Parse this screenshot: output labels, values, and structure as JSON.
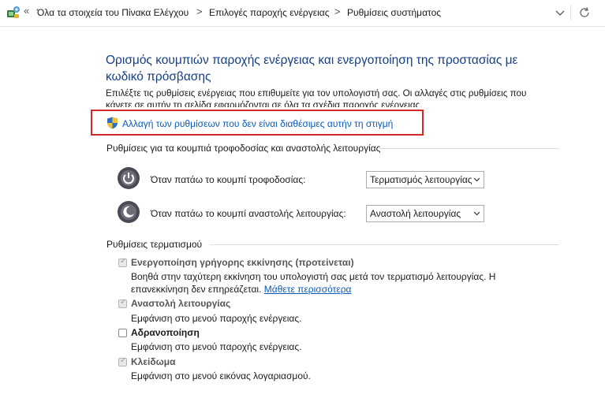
{
  "address_bar": {
    "crumbs": [
      "Όλα τα στοιχεία του Πίνακα Ελέγχου",
      "Επιλογές παροχής ενέργειας",
      "Ρυθμίσεις συστήματος"
    ],
    "separator": ">",
    "back_chevron": "«"
  },
  "page": {
    "title": "Ορισμός κουμπιών παροχής ενέργειας και ενεργοποίηση της προστασίας με κωδικό πρόσβασης",
    "description_line1": "Επιλέξτε τις ρυθμίσεις ενέργειας που επιθυμείτε για τον υπολογιστή σας. Οι αλλαγές στις ρυθμίσεις που",
    "description_line2": "κάνετε σε αυτήν τη σελίδα εφαρμόζονται σε όλα τα σχέδια παροχής ενέργειας.",
    "change_link": "Αλλαγή των ρυθμίσεων που δεν είναι διαθέσιμες αυτήν τη στιγμή"
  },
  "buttons_section": {
    "heading": "Ρυθμίσεις για τα κουμπιά τροφοδοσίας και αναστολής λειτουργίας",
    "rows": [
      {
        "label": "Όταν πατάω το κουμπί τροφοδοσίας:",
        "value": "Τερματισμός λειτουργίας",
        "icon": "power-button-icon"
      },
      {
        "label": "Όταν πατάω το κουμπί αναστολής λειτουργίας:",
        "value": "Αναστολή λειτουργίας",
        "icon": "sleep-button-icon"
      }
    ]
  },
  "shutdown_section": {
    "heading": "Ρυθμίσεις τερματισμού",
    "items": [
      {
        "label": "Ενεργοποίηση γρήγορης εκκίνησης (προτείνεται)",
        "checked": true,
        "desc1": "Βοηθά στην ταχύτερη εκκίνηση του υπολογιστή σας μετά τον τερματισμό λειτουργίας. Η",
        "desc2": "επανεκκίνηση δεν επηρεάζεται.",
        "link": "Μάθετε περισσότερα"
      },
      {
        "label": "Αναστολή λειτουργίας",
        "checked": true,
        "desc1": "Εμφάνιση στο μενού παροχής ενέργειας."
      },
      {
        "label": "Αδρανοποίηση",
        "checked": false,
        "desc1": "Εμφάνιση στο μενού παροχής ενέργειας."
      },
      {
        "label": "Κλείδωμα",
        "checked": true,
        "desc1": "Εμφάνιση στο μενού εικόνας λογαριασμού."
      }
    ]
  },
  "colors": {
    "title": "#153f84",
    "link": "#0b5bb6",
    "highlight_box": "#d0282b"
  }
}
